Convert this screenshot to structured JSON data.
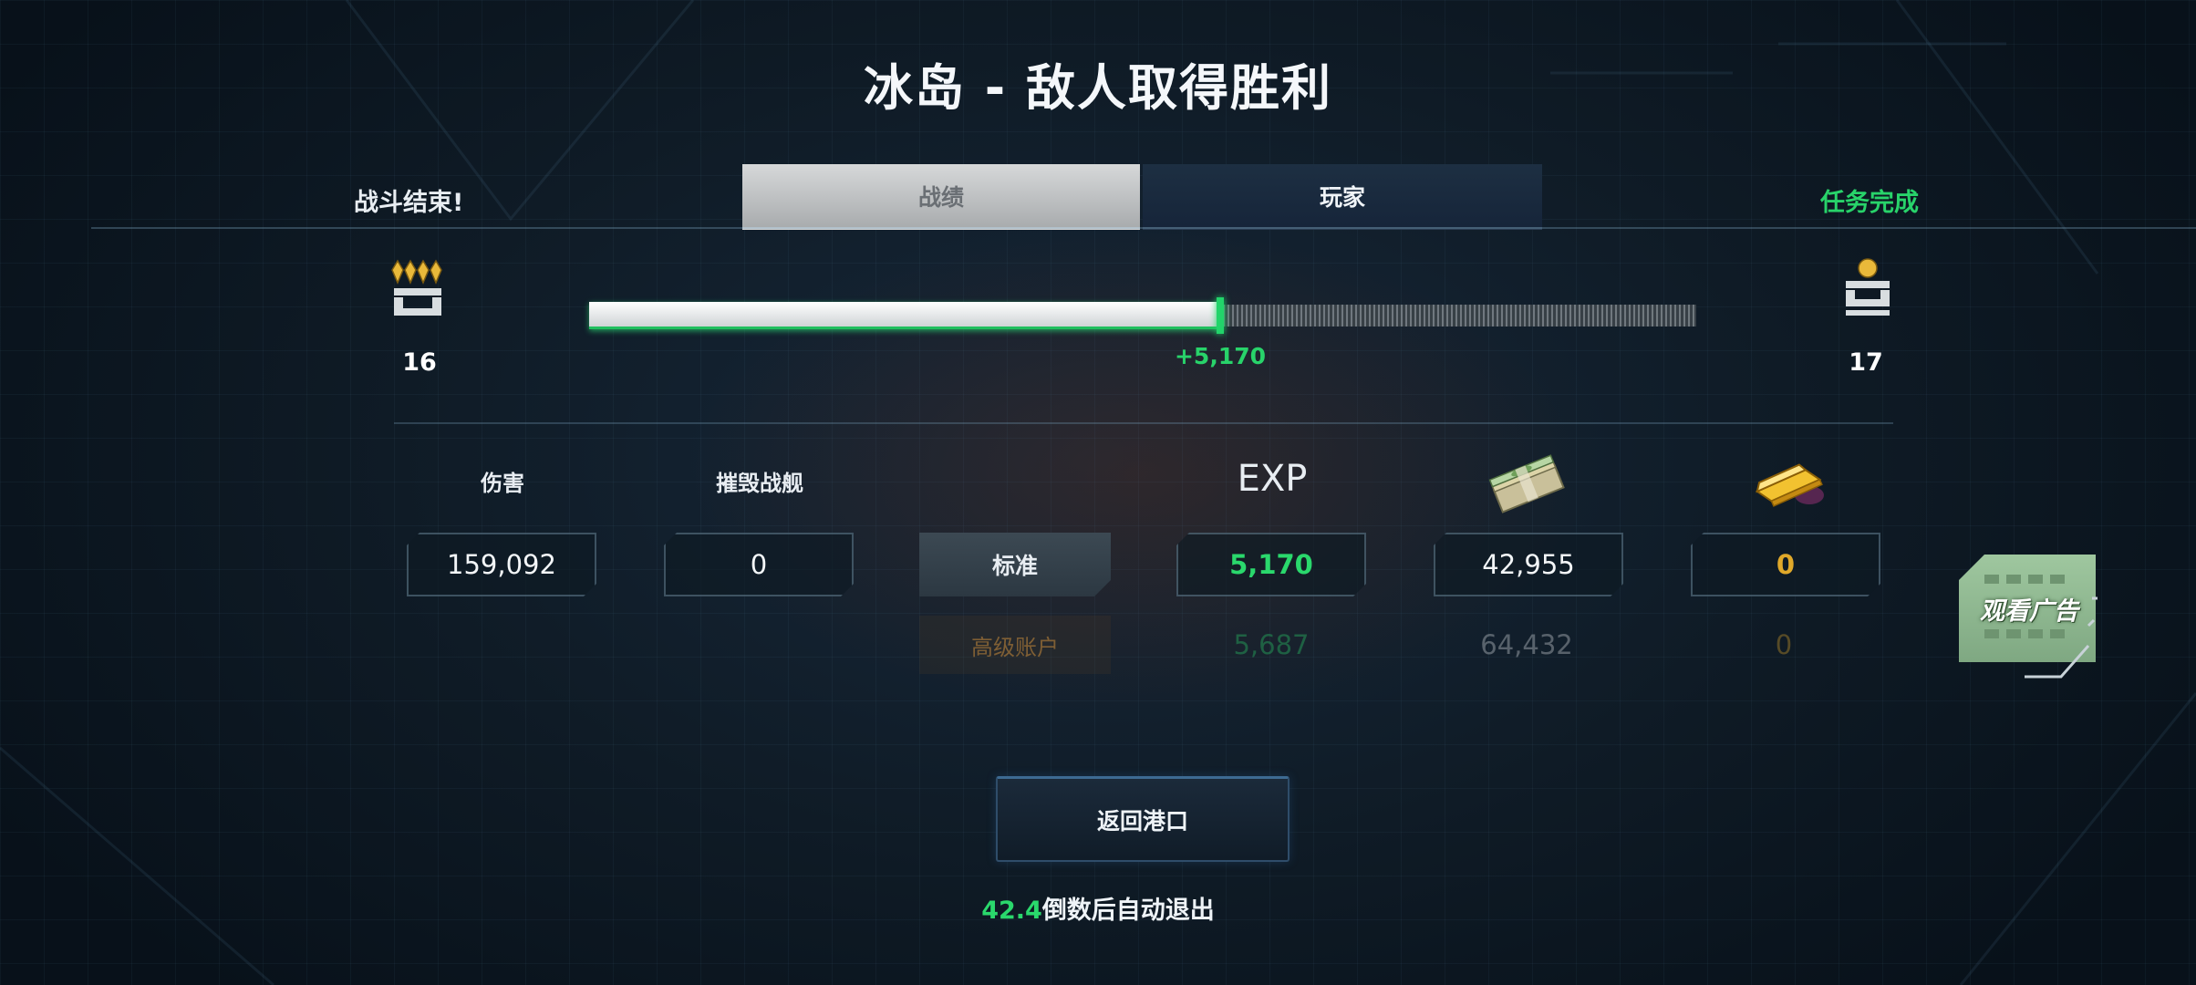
{
  "header": {
    "title": "冰岛 - 敌人取得胜利",
    "battle_status": "战斗结束!",
    "mission_status": "任务完成"
  },
  "tabs": [
    {
      "label": "战绩",
      "active": true
    },
    {
      "label": "玩家",
      "active": false
    }
  ],
  "progress": {
    "level_current": "16",
    "level_next": "17",
    "xp_gain_label": "+5,170",
    "fill_fraction": 0.57,
    "rank_icon_current": "rank-chevrons-icon",
    "rank_icon_next": "rank-star-icon"
  },
  "stats": {
    "headers": {
      "damage": "伤害",
      "ships_destroyed": "摧毁战舰",
      "exp": "EXP"
    },
    "standard": {
      "label": "标准",
      "damage": "159,092",
      "ships_destroyed": "0",
      "exp": "5,170",
      "credits": "42,955",
      "gold": "0"
    },
    "premium": {
      "label": "高级账户",
      "exp": "5,687",
      "credits": "64,432",
      "gold": "0"
    },
    "icons": {
      "credits": "money-stack-icon",
      "gold": "gold-bar-icon"
    }
  },
  "ad": {
    "label": "观看广告",
    "icon": "film-strip-icon"
  },
  "footer": {
    "return_label": "返回港口",
    "countdown_value": "42.4",
    "countdown_suffix": "倒数后自动退出"
  },
  "colors": {
    "accent_green": "#2ad86c",
    "gold": "#e0a92a",
    "tab_active": "#c4c7c9",
    "tab_inactive": "#1b2b3d"
  }
}
